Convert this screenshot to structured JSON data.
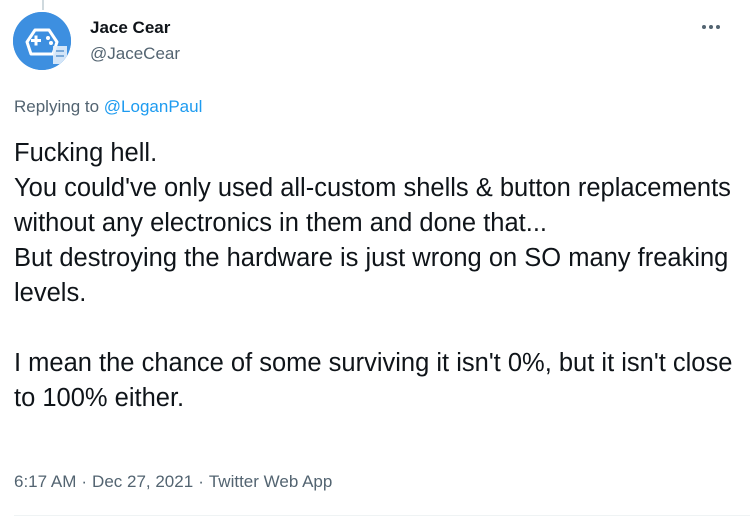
{
  "tweet": {
    "author": {
      "display_name": "Jace Cear",
      "handle": "@JaceCear",
      "avatar_icon": "gamepad-avatar-icon"
    },
    "more_icon": "more-options-icon",
    "replying_prefix": "Replying to",
    "replying_to": "@LoganPaul",
    "text": "Fucking hell.\nYou could've only used all-custom shells & button replacements without any electronics in them and done that...\nBut destroying the hardware is just wrong on SO many freaking levels.\n\nI mean the chance of some surviving it isn't 0%, but it isn't close to 100% either.",
    "time": "6:17 AM",
    "separator": "·",
    "date": "Dec 27, 2021",
    "source": "Twitter Web App"
  },
  "colors": {
    "accent": "#1d9bf0",
    "secondary_text": "#536471",
    "primary_text": "#0f1419",
    "avatar_bg": "#3d8fe0"
  }
}
